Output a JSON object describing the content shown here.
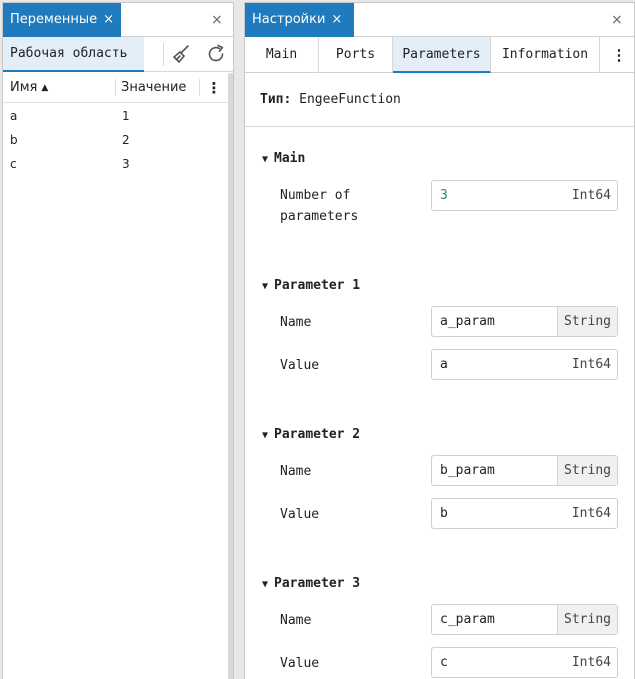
{
  "left": {
    "tab_label": "Переменные",
    "tab_close": "×",
    "window_close": "×",
    "workspace_label": "Рабочая область",
    "col_name": "Имя",
    "col_value": "Значение",
    "menu_glyph": "⋮",
    "rows": [
      {
        "name": "a",
        "value": "1"
      },
      {
        "name": "b",
        "value": "2"
      },
      {
        "name": "c",
        "value": "3"
      }
    ]
  },
  "right": {
    "tab_label": "Настройки",
    "tab_close": "×",
    "window_close": "×",
    "tabs": [
      "Main",
      "Ports",
      "Parameters",
      "Information"
    ],
    "active_tab": "Parameters",
    "menu_glyph": "⋮",
    "type_label": "Тип:",
    "type_value": "EngeeFunction",
    "main": {
      "title": "Main",
      "num_label_1": "Number of",
      "num_label_2": "parameters",
      "num_value": "3",
      "num_type": "Int64"
    },
    "params": [
      {
        "title": "Parameter 1",
        "name_label": "Name",
        "name_value": "a_param",
        "name_type": "String",
        "value_label": "Value",
        "value_value": "a",
        "value_type": "Int64"
      },
      {
        "title": "Parameter 2",
        "name_label": "Name",
        "name_value": "b_param",
        "name_type": "String",
        "value_label": "Value",
        "value_value": "b",
        "value_type": "Int64"
      },
      {
        "title": "Parameter 3",
        "name_label": "Name",
        "name_value": "c_param",
        "name_type": "String",
        "value_label": "Value",
        "value_value": "c",
        "value_type": "Int64"
      }
    ]
  },
  "colors": {
    "accent": "#1f7bbd",
    "tab_bg": "#e3eef8",
    "number_value": "#2a8a7a"
  },
  "icons": [
    "close-icon",
    "broom-icon",
    "refresh-icon",
    "sort-asc-icon",
    "more-vertical-icon",
    "triangle-down-icon"
  ]
}
